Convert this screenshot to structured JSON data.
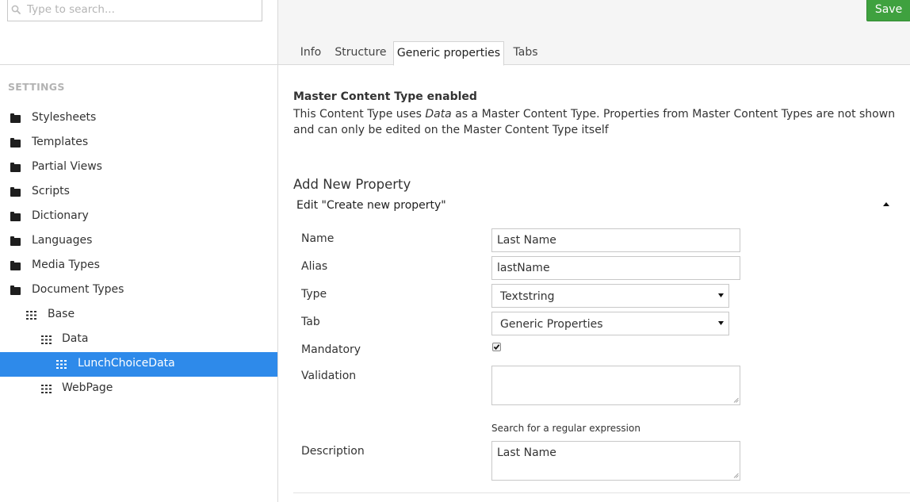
{
  "search": {
    "placeholder": "Type to search..."
  },
  "sidebar": {
    "section_label": "SETTINGS",
    "items": [
      {
        "label": "Stylesheets",
        "icon": "folder-icon"
      },
      {
        "label": "Templates",
        "icon": "folder-icon"
      },
      {
        "label": "Partial Views",
        "icon": "folder-icon"
      },
      {
        "label": "Scripts",
        "icon": "folder-icon"
      },
      {
        "label": "Dictionary",
        "icon": "folder-icon"
      },
      {
        "label": "Languages",
        "icon": "folder-icon"
      },
      {
        "label": "Media Types",
        "icon": "folder-icon"
      },
      {
        "label": "Document Types",
        "icon": "folder-icon"
      },
      {
        "label": "Base",
        "icon": "document-type-icon"
      },
      {
        "label": "Data",
        "icon": "document-type-icon"
      },
      {
        "label": "LunchChoiceData",
        "icon": "document-type-icon",
        "selected": true
      },
      {
        "label": "WebPage",
        "icon": "document-type-icon"
      }
    ]
  },
  "toolbar": {
    "save_label": "Save"
  },
  "tabs": [
    {
      "label": "Info"
    },
    {
      "label": "Structure"
    },
    {
      "label": "Generic properties",
      "active": true
    },
    {
      "label": "Tabs"
    }
  ],
  "master": {
    "title": "Master Content Type enabled",
    "desc_prefix": "This Content Type uses ",
    "desc_em": "Data",
    "desc_suffix": " as a Master Content Type. Properties from Master Content Types are not shown and can only be edited on the Master Content Type itself"
  },
  "add_new": {
    "title": "Add New Property",
    "edit_title": "Edit \"Create new property\""
  },
  "form": {
    "name": {
      "label": "Name",
      "value": "Last Name"
    },
    "alias": {
      "label": "Alias",
      "value": "lastName"
    },
    "type": {
      "label": "Type",
      "value": "Textstring"
    },
    "tab": {
      "label": "Tab",
      "value": "Generic Properties"
    },
    "mandatory": {
      "label": "Mandatory",
      "checked": true
    },
    "validation": {
      "label": "Validation",
      "value": ""
    },
    "regex_link": "Search for a regular expression",
    "description": {
      "label": "Description",
      "value": "Last Name"
    }
  },
  "colors": {
    "accent": "#2e8aea",
    "save_green": "#3fa13f",
    "section_gray": "#b3b3b3"
  }
}
